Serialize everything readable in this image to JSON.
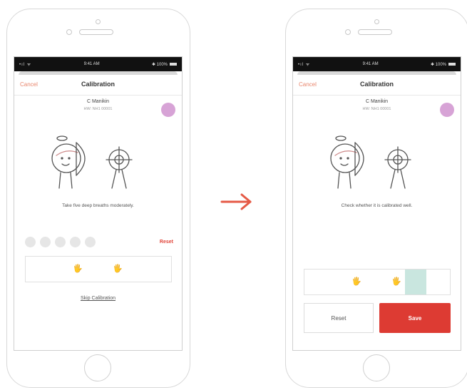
{
  "colors": {
    "accent": "#dd3b33",
    "cancel": "#e9866d",
    "avatar": "#d7a3d6",
    "highlight": "#b7ddd4"
  },
  "left": {
    "statusbar": {
      "signal": "•ıl ᯤ",
      "time": "9:41 AM",
      "battery": "✱ 100%"
    },
    "nav": {
      "cancel": "Cancel",
      "title": "Calibration"
    },
    "manikin": {
      "name": "C Manikin",
      "id": "HW: NH1 00001"
    },
    "instruction": "Take five deep breaths moderately.",
    "reset": "Reset",
    "hand_glyph": "🖐",
    "skip": "Skip Calibration"
  },
  "right": {
    "statusbar": {
      "signal": "•ıl ᯤ",
      "time": "9:41 AM",
      "battery": "✱ 100%"
    },
    "nav": {
      "cancel": "Cancel",
      "title": "Calibration"
    },
    "manikin": {
      "name": "C Manikin",
      "id": "HW: NH1 00001"
    },
    "instruction": "Check whether it is calibrated well.",
    "hand_glyph": "🖐",
    "buttons": {
      "reset": "Reset",
      "save": "Save"
    }
  },
  "icons": {
    "transition": "arrow-right-icon"
  }
}
